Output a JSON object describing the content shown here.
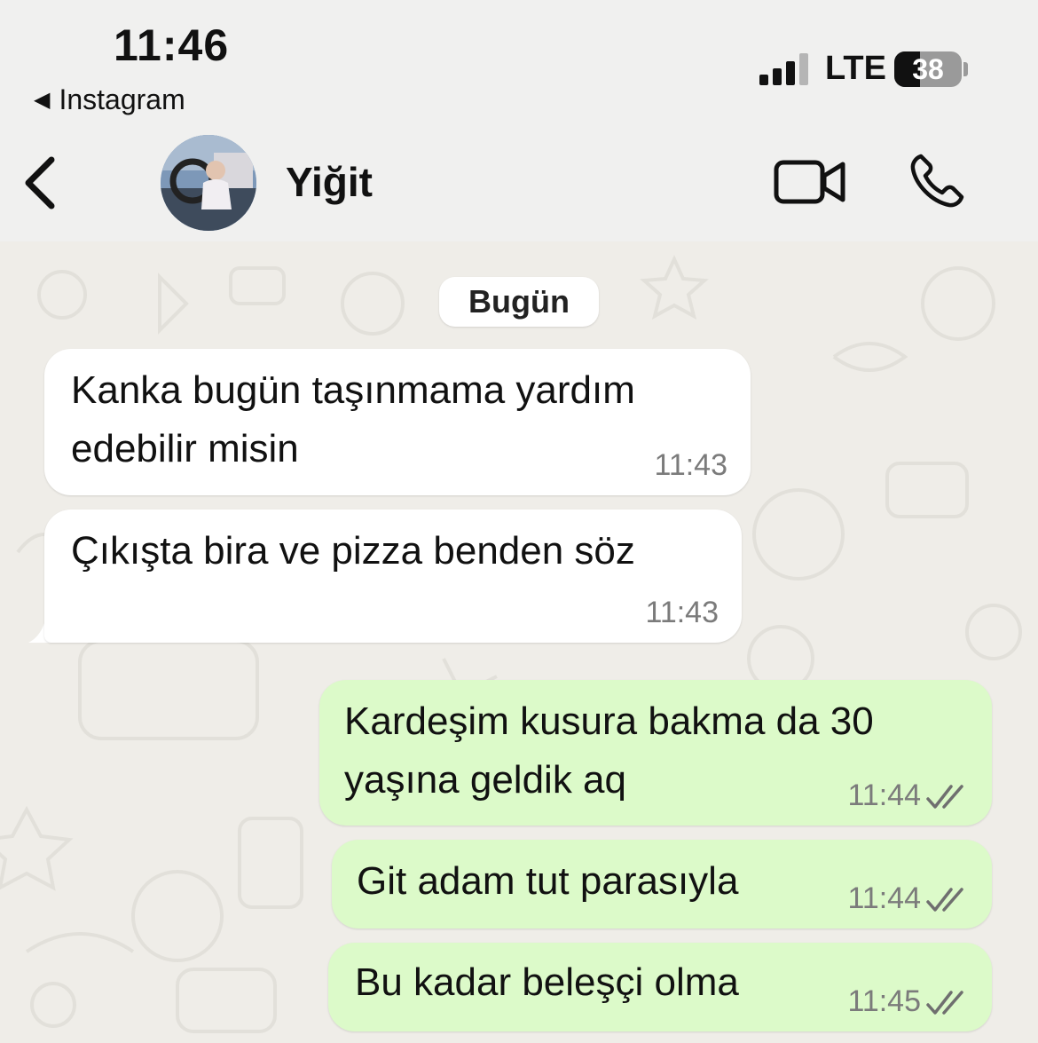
{
  "status_bar": {
    "time": "11:46",
    "back_app": "Instagram",
    "network": "LTE",
    "battery": "38",
    "battery_level": 0.38
  },
  "header": {
    "contact_name": "Yiğit",
    "icons": [
      "chevron-left-icon",
      "video-camera-icon",
      "phone-icon"
    ]
  },
  "chat": {
    "date_label": "Bugün",
    "messages": [
      {
        "direction": "incoming",
        "lines": [
          "Kanka bugün taşınmama yardım",
          "edebilir misin"
        ],
        "time": "11:43"
      },
      {
        "direction": "incoming",
        "lines": [
          "Çıkışta bira ve pizza benden söz"
        ],
        "time": "11:43"
      },
      {
        "direction": "outgoing",
        "lines": [
          "Kardeşim kusura bakma da 30",
          "yaşına geldik aq"
        ],
        "time": "11:44",
        "status": "read"
      },
      {
        "direction": "outgoing",
        "lines": [
          "Git adam tut parasıyla"
        ],
        "time": "11:44",
        "status": "read"
      },
      {
        "direction": "outgoing",
        "lines": [
          "Bu kadar beleşçi olma"
        ],
        "time": "11:45",
        "status": "read"
      }
    ]
  },
  "colors": {
    "incoming_bubble": "#ffffff",
    "outgoing_bubble": "#dcfac9",
    "chat_background": "#efede8",
    "header_background": "#f0f0ef",
    "read_ticks": "#6f6f6f"
  }
}
